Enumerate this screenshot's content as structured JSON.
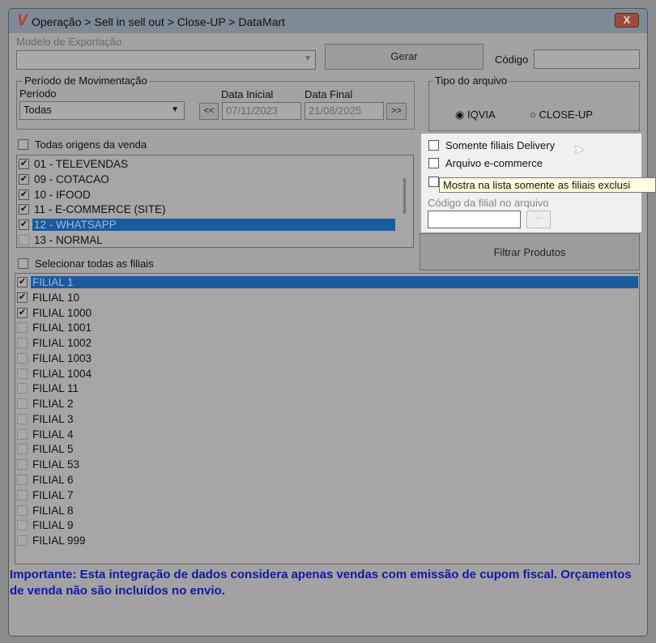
{
  "window": {
    "title": "Operação > Sell in sell out > Close-UP > DataMart",
    "close": "X"
  },
  "export": {
    "model_label": "Modelo de Exportação",
    "model_value": "",
    "generate": "Gerar",
    "code_label": "Código",
    "code_value": ""
  },
  "period": {
    "group": "Período de Movimentação",
    "label": "Período",
    "value": "Todas",
    "start_label": "Data Inicial",
    "start": "07/11/2023",
    "end_label": "Data Final",
    "end": "21/08/2025",
    "prev": "<<",
    "next": ">>"
  },
  "file_type": {
    "group": "Tipo do arquivo",
    "options": [
      "IQVIA",
      "CLOSE-UP"
    ],
    "selected": "IQVIA"
  },
  "options": {
    "delivery": "Somente filiais Delivery",
    "ecommerce": "Arquivo e-commerce",
    "tooltip": "Mostra na lista somente as filiais exclusi",
    "branch_code_label": "Código da filial no arquivo",
    "branch_code": "",
    "browse": "..."
  },
  "filter_products": "Filtrar Produtos",
  "origins": {
    "all_label": "Todas origens da venda",
    "items": [
      {
        "label": "01 - TELEVENDAS",
        "checked": true
      },
      {
        "label": "09 - COTACAO",
        "checked": true
      },
      {
        "label": "10 - IFOOD",
        "checked": true
      },
      {
        "label": "11 - E-COMMERCE (SITE)",
        "checked": true
      },
      {
        "label": "12 - WHATSAPP",
        "checked": true,
        "selected": true
      },
      {
        "label": "13 - NORMAL",
        "checked": false
      }
    ]
  },
  "branches": {
    "all_label": "Selecionar todas as filiais",
    "items": [
      {
        "label": "FILIAL 1",
        "checked": true,
        "selected": true
      },
      {
        "label": "FILIAL 10",
        "checked": true
      },
      {
        "label": "FILIAL 1000",
        "checked": true
      },
      {
        "label": "FILIAL 1001",
        "checked": false
      },
      {
        "label": "FILIAL 1002",
        "checked": false
      },
      {
        "label": "FILIAL 1003",
        "checked": false
      },
      {
        "label": "FILIAL 1004",
        "checked": false
      },
      {
        "label": "FILIAL 11",
        "checked": false
      },
      {
        "label": "FILIAL 2",
        "checked": false
      },
      {
        "label": "FILIAL 3",
        "checked": false
      },
      {
        "label": "FILIAL 4",
        "checked": false
      },
      {
        "label": "FILIAL 5",
        "checked": false
      },
      {
        "label": "FILIAL 53",
        "checked": false
      },
      {
        "label": "FILIAL 6",
        "checked": false
      },
      {
        "label": "FILIAL 7",
        "checked": false
      },
      {
        "label": "FILIAL 8",
        "checked": false
      },
      {
        "label": "FILIAL 9",
        "checked": false
      },
      {
        "label": "FILIAL 999",
        "checked": false
      }
    ]
  },
  "note": "Importante: Esta integração de dados considera apenas vendas com emissão de cupom fiscal. Orçamentos de venda não são incluídos no envio."
}
